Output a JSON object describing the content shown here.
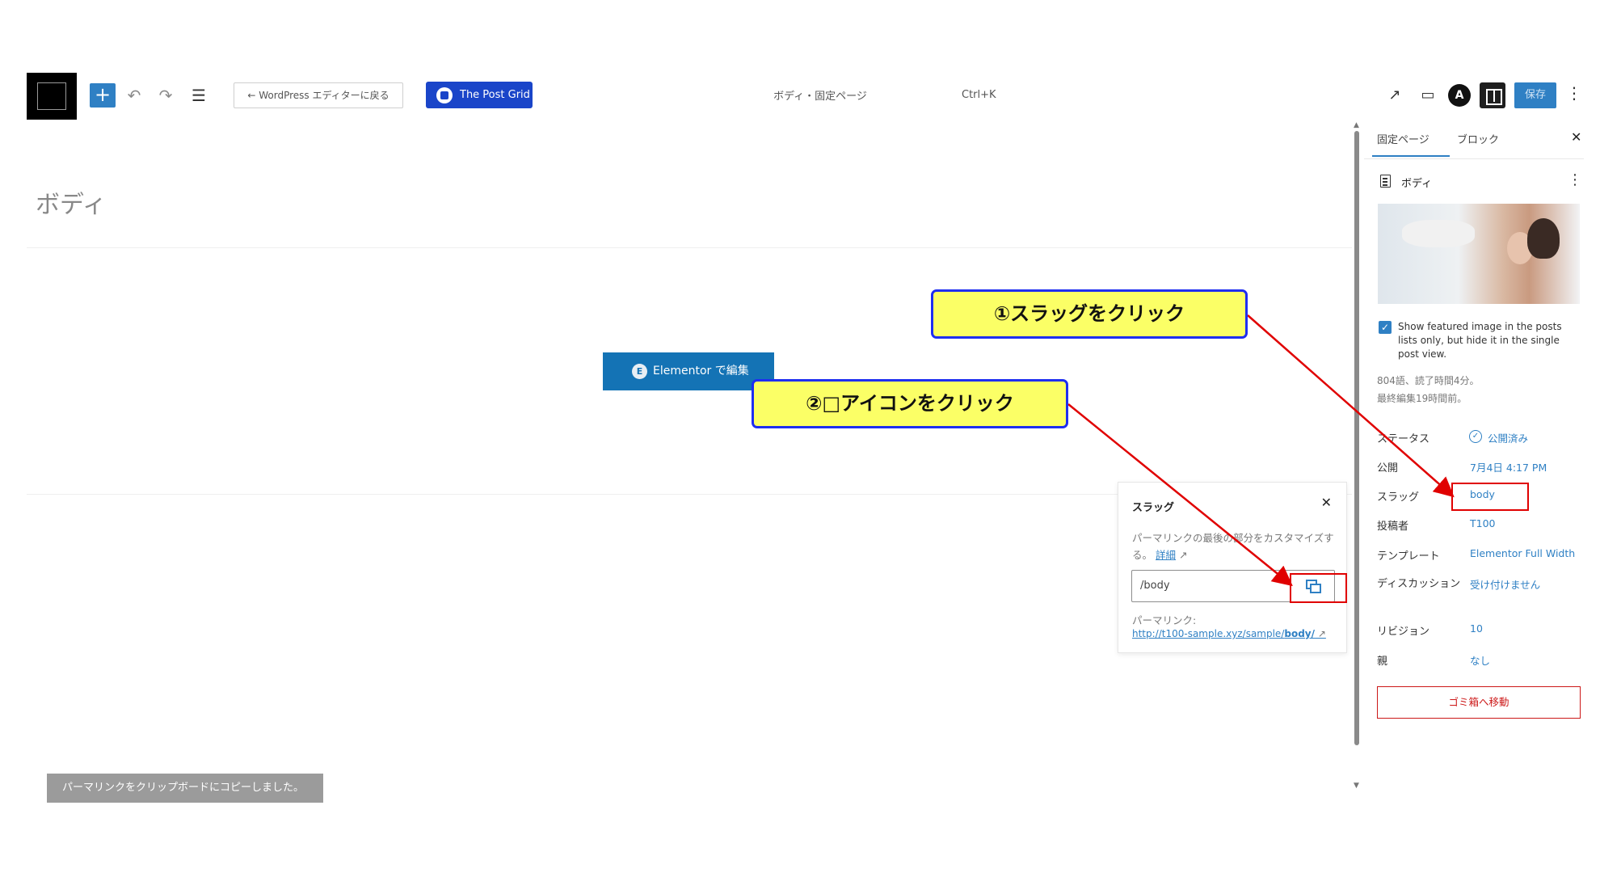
{
  "toolbar": {
    "back_label": "← WordPress エディターに戻る",
    "postgrid_label": "The Post Grid",
    "doc_title": "ボディ・固定ページ",
    "shortcut": "Ctrl+K",
    "astra_letter": "A",
    "save_label": "保存"
  },
  "editor": {
    "page_title": "ボディ",
    "elementor_label": "Elementor で編集",
    "elementor_icon": "E"
  },
  "slug_popover": {
    "title": "スラッグ",
    "description": "パーマリンクの最後の部分をカスタマイズする。",
    "details_link": "詳細",
    "slug_value": "/body",
    "permalink_label": "パーマリンク:",
    "permalink_prefix": "http://t100-sample.xyz/sample/",
    "permalink_slug": "body/"
  },
  "snackbar": {
    "message": "パーマリンクをクリップボードにコピーしました。"
  },
  "sidebar": {
    "tabs": [
      {
        "label": "固定ページ"
      },
      {
        "label": "ブロック"
      }
    ],
    "post_title": "ボディ",
    "show_featured_label": "Show featured image in the posts lists only, but hide it in the single post view.",
    "word_count": "804語、読了時間4分。",
    "last_edited": "最終編集19時間前。",
    "meta": [
      {
        "label": "ステータス",
        "value": "公開済み"
      },
      {
        "label": "公開",
        "value": "7月4日 4:17 PM"
      },
      {
        "label": "スラッグ",
        "value": "body"
      },
      {
        "label": "投稿者",
        "value": "T100"
      },
      {
        "label": "テンプレート",
        "value": "Elementor Full Width"
      },
      {
        "label": "ディスカッション",
        "value": "受け付けません"
      },
      {
        "label": "リビジョン",
        "value": "10"
      },
      {
        "label": "親",
        "value": "なし"
      }
    ],
    "trash_label": "ゴミ箱へ移動"
  },
  "annotations": {
    "callout_1": "①スラッグをクリック",
    "callout_2": "②□アイコンをクリック"
  },
  "colors": {
    "accent": "#2f80c4",
    "postgrid": "#1a45c9",
    "elementor": "#1473b5",
    "callout_fill": "#fbff66",
    "callout_border": "#1e2ef0",
    "annotation_red": "#e00000",
    "danger": "#cc1818"
  }
}
